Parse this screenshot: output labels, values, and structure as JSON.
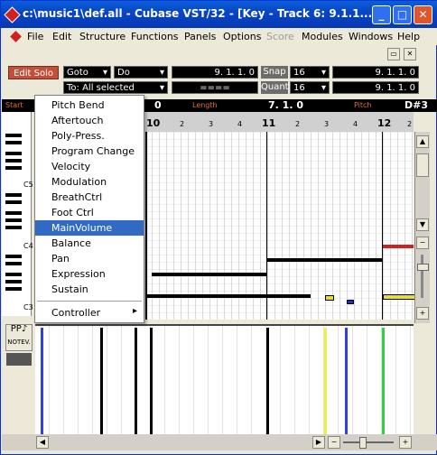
{
  "window": {
    "title": "c:\\music1\\def.all - Cubase VST/32 - [Key - Track 6:  9.1.1....",
    "minimize": "_",
    "maximize": "□",
    "close": "✕"
  },
  "menu": [
    "File",
    "Edit",
    "Structure",
    "Functions",
    "Panels",
    "Options",
    "Score",
    "Modules",
    "Windows",
    "Help"
  ],
  "toolbar": {
    "edit_solo": "Edit Solo",
    "goto": "Goto",
    "do": "Do",
    "pos1": "9.  1.  1.      0",
    "snap_label": "Snap",
    "snap_val": "16",
    "pos2": "9.  1.  1.      0",
    "to_all": "To: All selected",
    "eq": "====",
    "quant_label": "Quant",
    "quant_val": "16",
    "pos3": "9.  1.  1.      0"
  },
  "infobar": {
    "start_lbl": "Start",
    "val0": "0",
    "length_lbl": "Length",
    "len_val": "7.  1.      0",
    "pitch_lbl": "Pitch",
    "pitch_val": "D#3"
  },
  "ruler": {
    "bars": [
      "10",
      "11",
      "12"
    ],
    "beats": [
      "2",
      "3",
      "4",
      "2",
      "3",
      "4",
      "2"
    ]
  },
  "keyboard": {
    "c_labels": [
      "C5",
      "C4",
      "C3"
    ]
  },
  "context_menu": {
    "items": [
      "Pitch Bend",
      "Aftertouch",
      "Poly-Press.",
      "Program Change",
      "Velocity",
      "Modulation",
      "BreathCtrl",
      "Foot Ctrl",
      "MainVolume",
      "Balance",
      "Pan",
      "Expression",
      "Sustain"
    ],
    "selected": "MainVolume",
    "controller": "Controller",
    "submenu_arrow": "▸"
  },
  "controller_box": {
    "label1": "PP",
    "label2": "NOTEV."
  },
  "colors": {
    "title_bg": "#0846c6",
    "selected_bg": "#316ac5",
    "edit_solo_bg": "#c0503a",
    "note": "#000000",
    "note_red": "#cc2222",
    "note_yellow": "#e8e020",
    "note_blue": "#2030d0",
    "ctrl_yellow": "#f0f040",
    "ctrl_blue": "#3040e0",
    "ctrl_green": "#30d040"
  },
  "icons": {
    "app": "cubase-diamond-icon",
    "minimize": "minimize-icon",
    "maximize": "maximize-icon",
    "close": "close-icon"
  }
}
